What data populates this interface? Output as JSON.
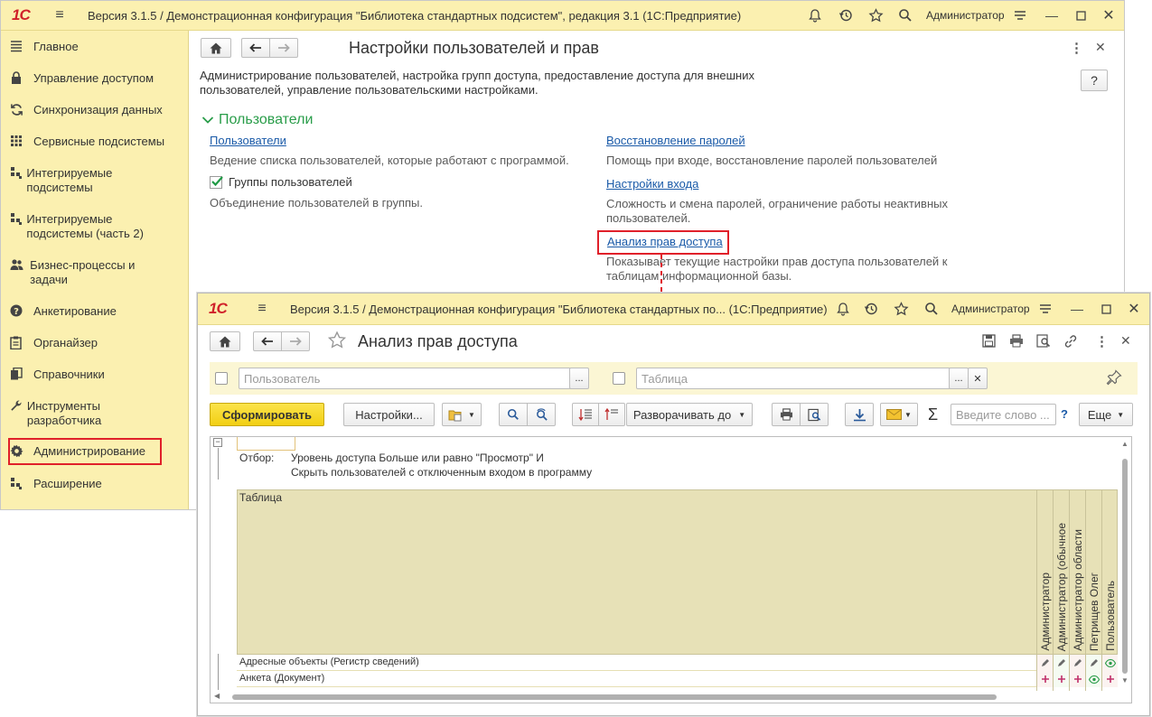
{
  "window1": {
    "logo": "1С",
    "title": "Версия 3.1.5 / Демонстрационная конфигурация \"Библиотека стандартных подсистем\", редакция 3.1  (1С:Предприятие)",
    "user": "Администратор"
  },
  "sidebar": {
    "items": [
      {
        "label": "Главное",
        "icon": "list-icon"
      },
      {
        "label": "Управление доступом",
        "icon": "lock-icon"
      },
      {
        "label": "Синхронизация данных",
        "icon": "sync-icon"
      },
      {
        "label": "Сервисные подсистемы",
        "icon": "grid-icon"
      },
      {
        "label": "Интегрируемые подсистемы",
        "icon": "modules-icon"
      },
      {
        "label": "Интегрируемые подсистемы (часть 2)",
        "icon": "modules-icon"
      },
      {
        "label": "Бизнес-процессы и задачи",
        "icon": "people-icon"
      },
      {
        "label": "Анкетирование",
        "icon": "question-icon"
      },
      {
        "label": "Органайзер",
        "icon": "clipboard-icon"
      },
      {
        "label": "Справочники",
        "icon": "books-icon"
      },
      {
        "label": "Инструменты разработчика",
        "icon": "wrench-icon"
      },
      {
        "label": "Администрирование",
        "icon": "gear-icon"
      },
      {
        "label": "Расширение",
        "icon": "modules-icon"
      }
    ]
  },
  "page1": {
    "title": "Настройки пользователей и прав",
    "description": "Администрирование пользователей, настройка групп доступа, предоставление доступа для внешних пользователей, управление пользовательскими настройками.",
    "help": "?",
    "section_title": "Пользователи",
    "left": {
      "users_link": "Пользователи",
      "users_desc": "Ведение списка пользователей, которые работают с программой.",
      "groups_label": "Группы пользователей",
      "groups_checked": true,
      "groups_desc": "Объединение пользователей в группы."
    },
    "right": {
      "recovery_link": "Восстановление паролей",
      "recovery_desc": "Помощь при входе, восстановление паролей пользователей",
      "login_link": "Настройки входа",
      "login_desc": "Сложность и смена паролей, ограничение работы неактивных пользователей.",
      "analysis_link": "Анализ прав доступа",
      "analysis_desc": "Показывает текущие настройки прав доступа пользователей к таблицам информационной базы."
    }
  },
  "window2": {
    "logo": "1С",
    "title": "Версия 3.1.5 / Демонстрационная конфигурация \"Библиотека стандартных по...  (1С:Предприятие)",
    "user": "Администратор",
    "page_title": "Анализ прав доступа",
    "filter_user_placeholder": "Пользователь",
    "filter_table_placeholder": "Таблица",
    "toolbar": {
      "generate": "Сформировать",
      "settings": "Настройки...",
      "expand_to": "Разворачивать до",
      "search_placeholder": "Введите слово ...",
      "help": "?",
      "more": "Еще"
    },
    "report": {
      "filter_label": "Отбор:",
      "filter_line1": "Уровень доступа Больше или равно \"Просмотр\" И",
      "filter_line2": "Скрыть пользователей с отключенным входом в программу",
      "table_header": "Таблица",
      "columns": [
        "Администратор",
        "Администратор (обычное",
        "Администратор области",
        "Петрищев Олег",
        "Пользователь"
      ],
      "rows": [
        {
          "name": "Адресные объекты (Регистр сведений)",
          "marks": [
            "edit",
            "edit",
            "edit",
            "edit",
            "view"
          ]
        },
        {
          "name": "Анкета (Документ)",
          "marks": [
            "add",
            "add",
            "add",
            "view",
            "add"
          ]
        }
      ]
    }
  }
}
